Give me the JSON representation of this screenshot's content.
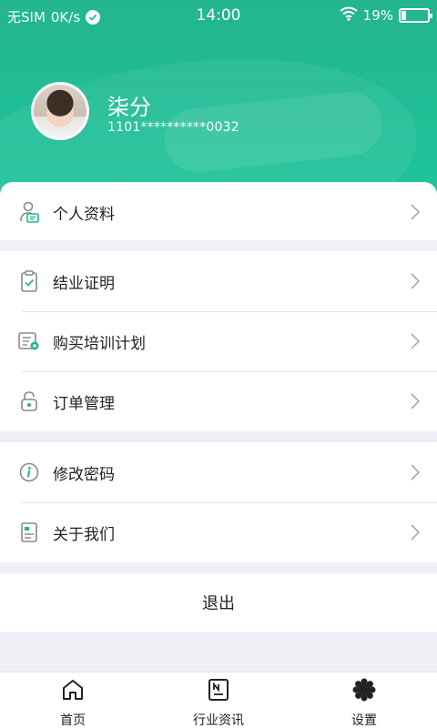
{
  "status_bar": {
    "carrier": "无SIM",
    "speed": "0K/s",
    "time": "14:00",
    "battery": "19%",
    "battery_level": 0.19
  },
  "profile": {
    "name": "柒分",
    "id": "1101**********0032"
  },
  "menu": {
    "group1": [
      {
        "label": "个人资料",
        "icon": "person-card-icon"
      }
    ],
    "group2": [
      {
        "label": "结业证明",
        "icon": "clipboard-check-icon"
      },
      {
        "label": "购买培训计划",
        "icon": "plan-list-icon"
      },
      {
        "label": "订单管理",
        "icon": "lock-icon"
      }
    ],
    "group3": [
      {
        "label": "修改密码",
        "icon": "info-icon"
      },
      {
        "label": "关于我们",
        "icon": "document-icon"
      }
    ],
    "logout_label": "退出"
  },
  "tabbar": {
    "tabs": [
      {
        "label": "首页",
        "icon": "home-icon"
      },
      {
        "label": "行业资讯",
        "icon": "news-icon"
      },
      {
        "label": "设置",
        "icon": "gear-icon",
        "active": true
      }
    ]
  },
  "colors": {
    "header_start": "#23b58f",
    "header_end": "#1fc69d",
    "accent": "#21b58f",
    "page_bg": "#eef0f5"
  }
}
